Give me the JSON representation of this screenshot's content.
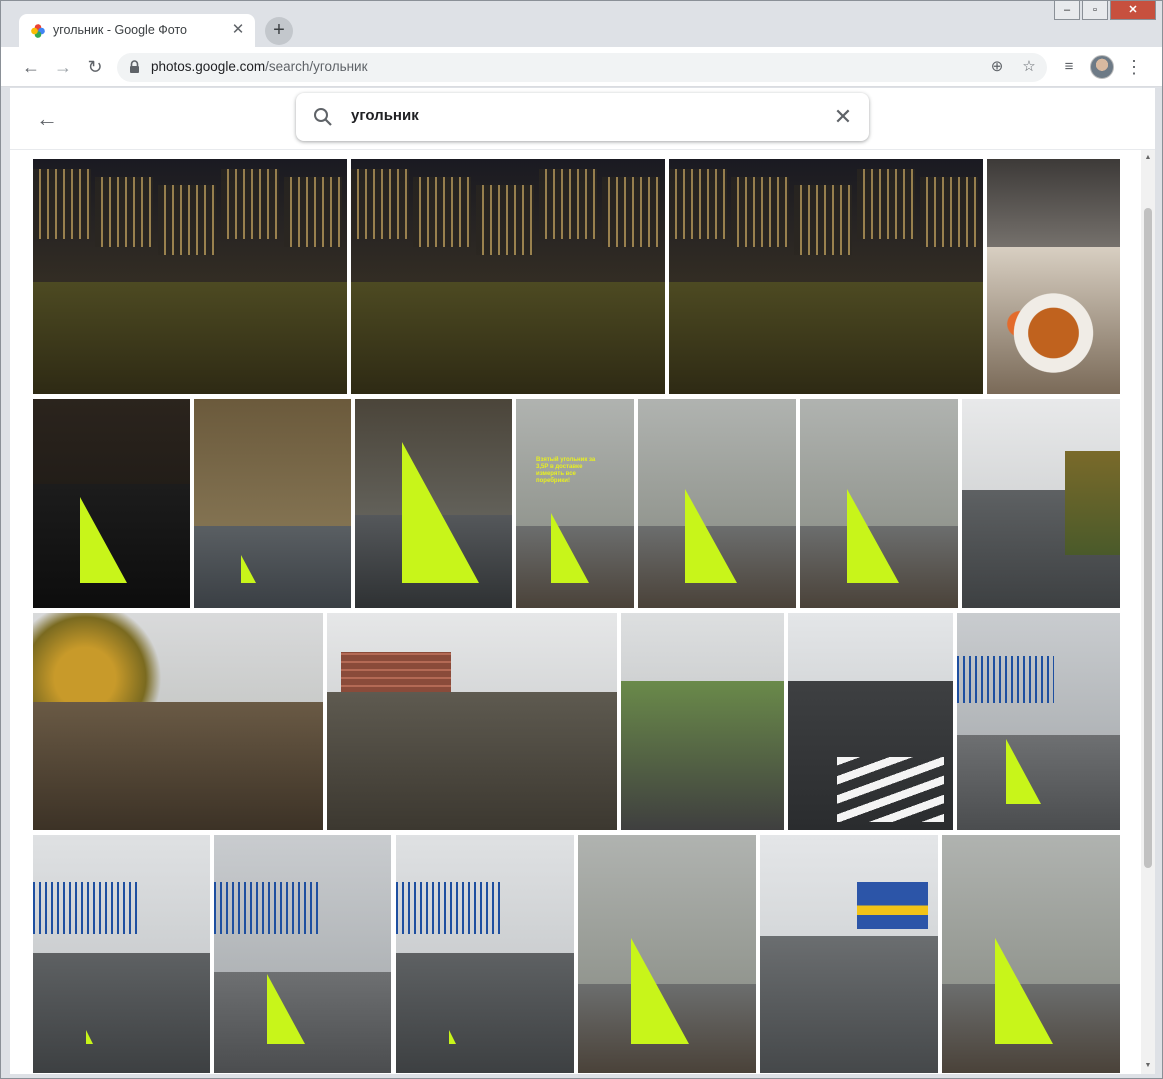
{
  "browser": {
    "tab_title": "угольник - Google Фото",
    "new_tab_label": "+",
    "url_host": "photos.google.com",
    "url_path": "/search/угольник"
  },
  "search": {
    "query": "угольник"
  },
  "photos": [
    {
      "scene": "night-street"
    },
    {
      "scene": "night-street"
    },
    {
      "scene": "night-street"
    },
    {
      "scene": "food-collage"
    },
    {
      "scene": "ruler-dark"
    },
    {
      "scene": "ruler-puddle"
    },
    {
      "scene": "ruler-closeup"
    },
    {
      "scene": "ruler-curb",
      "caption": "Взятый угольник за 3,5Р в доставке измерять все поребрики!"
    },
    {
      "scene": "ruler-curb"
    },
    {
      "scene": "ruler-curb"
    },
    {
      "scene": "sidewalk"
    },
    {
      "scene": "autumn-road"
    },
    {
      "scene": "muddy-road"
    },
    {
      "scene": "fence-street"
    },
    {
      "scene": "crosswalk"
    },
    {
      "scene": "ruler-fence"
    },
    {
      "scene": "sidewalk-fence"
    },
    {
      "scene": "ruler-fence"
    },
    {
      "scene": "sidewalk-fence"
    },
    {
      "scene": "ruler-curb"
    },
    {
      "scene": "sidewalk-store"
    },
    {
      "scene": "ruler-curb"
    }
  ],
  "colors": {
    "ruler": "#c8f51a",
    "accent": "#1a73e8"
  }
}
